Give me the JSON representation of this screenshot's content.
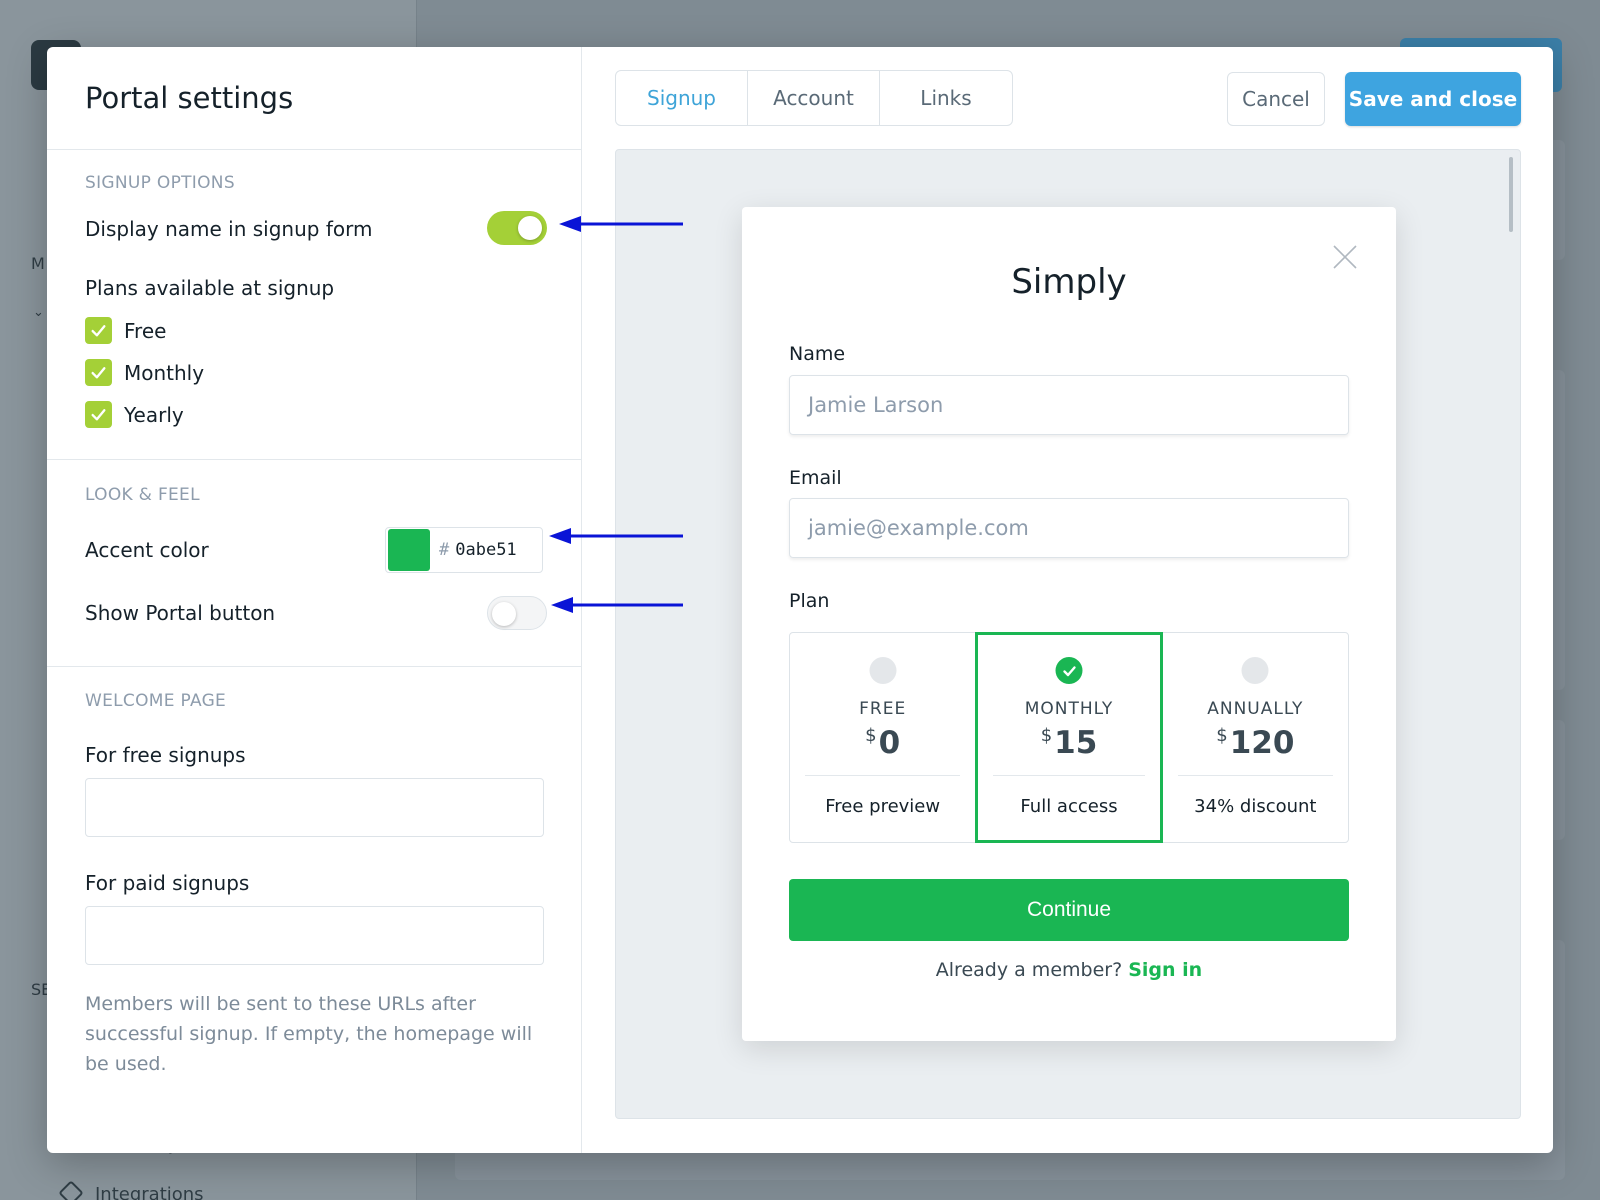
{
  "background": {
    "sidebar_fragments": [
      "M",
      "SE"
    ],
    "integrations_label": "Integrations",
    "partial_text": "y"
  },
  "modal": {
    "title": "Portal settings",
    "sections": {
      "signup_options": {
        "label": "SIGNUP OPTIONS",
        "display_name_label": "Display name in signup form",
        "display_name_enabled": true,
        "plans_label": "Plans available at signup",
        "plans": [
          {
            "label": "Free",
            "checked": true
          },
          {
            "label": "Monthly",
            "checked": true
          },
          {
            "label": "Yearly",
            "checked": true
          }
        ]
      },
      "look_feel": {
        "label": "LOOK & FEEL",
        "accent_label": "Accent color",
        "accent_hash": "#",
        "accent_value": "0abe51",
        "accent_color": "#1ab653",
        "portal_button_label": "Show Portal button",
        "portal_button_enabled": false
      },
      "welcome_page": {
        "label": "WELCOME PAGE",
        "free_label": "For free signups",
        "free_value": "",
        "paid_label": "For paid signups",
        "paid_value": "",
        "help_text": "Members will be sent to these URLs after successful signup. If empty, the homepage will be used."
      }
    },
    "tabs": [
      {
        "label": "Signup",
        "active": true
      },
      {
        "label": "Account",
        "active": false
      },
      {
        "label": "Links",
        "active": false
      }
    ],
    "cancel_label": "Cancel",
    "save_label": "Save and close"
  },
  "preview": {
    "brand": "Simply",
    "name_label": "Name",
    "name_placeholder": "Jamie Larson",
    "email_label": "Email",
    "email_placeholder": "jamie@example.com",
    "plan_label": "Plan",
    "plans": [
      {
        "name": "FREE",
        "currency": "$",
        "price": "0",
        "desc": "Free preview",
        "selected": false
      },
      {
        "name": "MONTHLY",
        "currency": "$",
        "price": "15",
        "desc": "Full access",
        "selected": true
      },
      {
        "name": "ANNUALLY",
        "currency": "$",
        "price": "120",
        "desc": "34% discount",
        "selected": false
      }
    ],
    "continue_label": "Continue",
    "member_text": "Already a member?",
    "signin_label": "Sign in"
  },
  "colors": {
    "toggle_on": "#a4d037",
    "accent_green": "#1ab653",
    "save_blue": "#3ea4e0",
    "arrow_blue": "#0a14d6"
  }
}
